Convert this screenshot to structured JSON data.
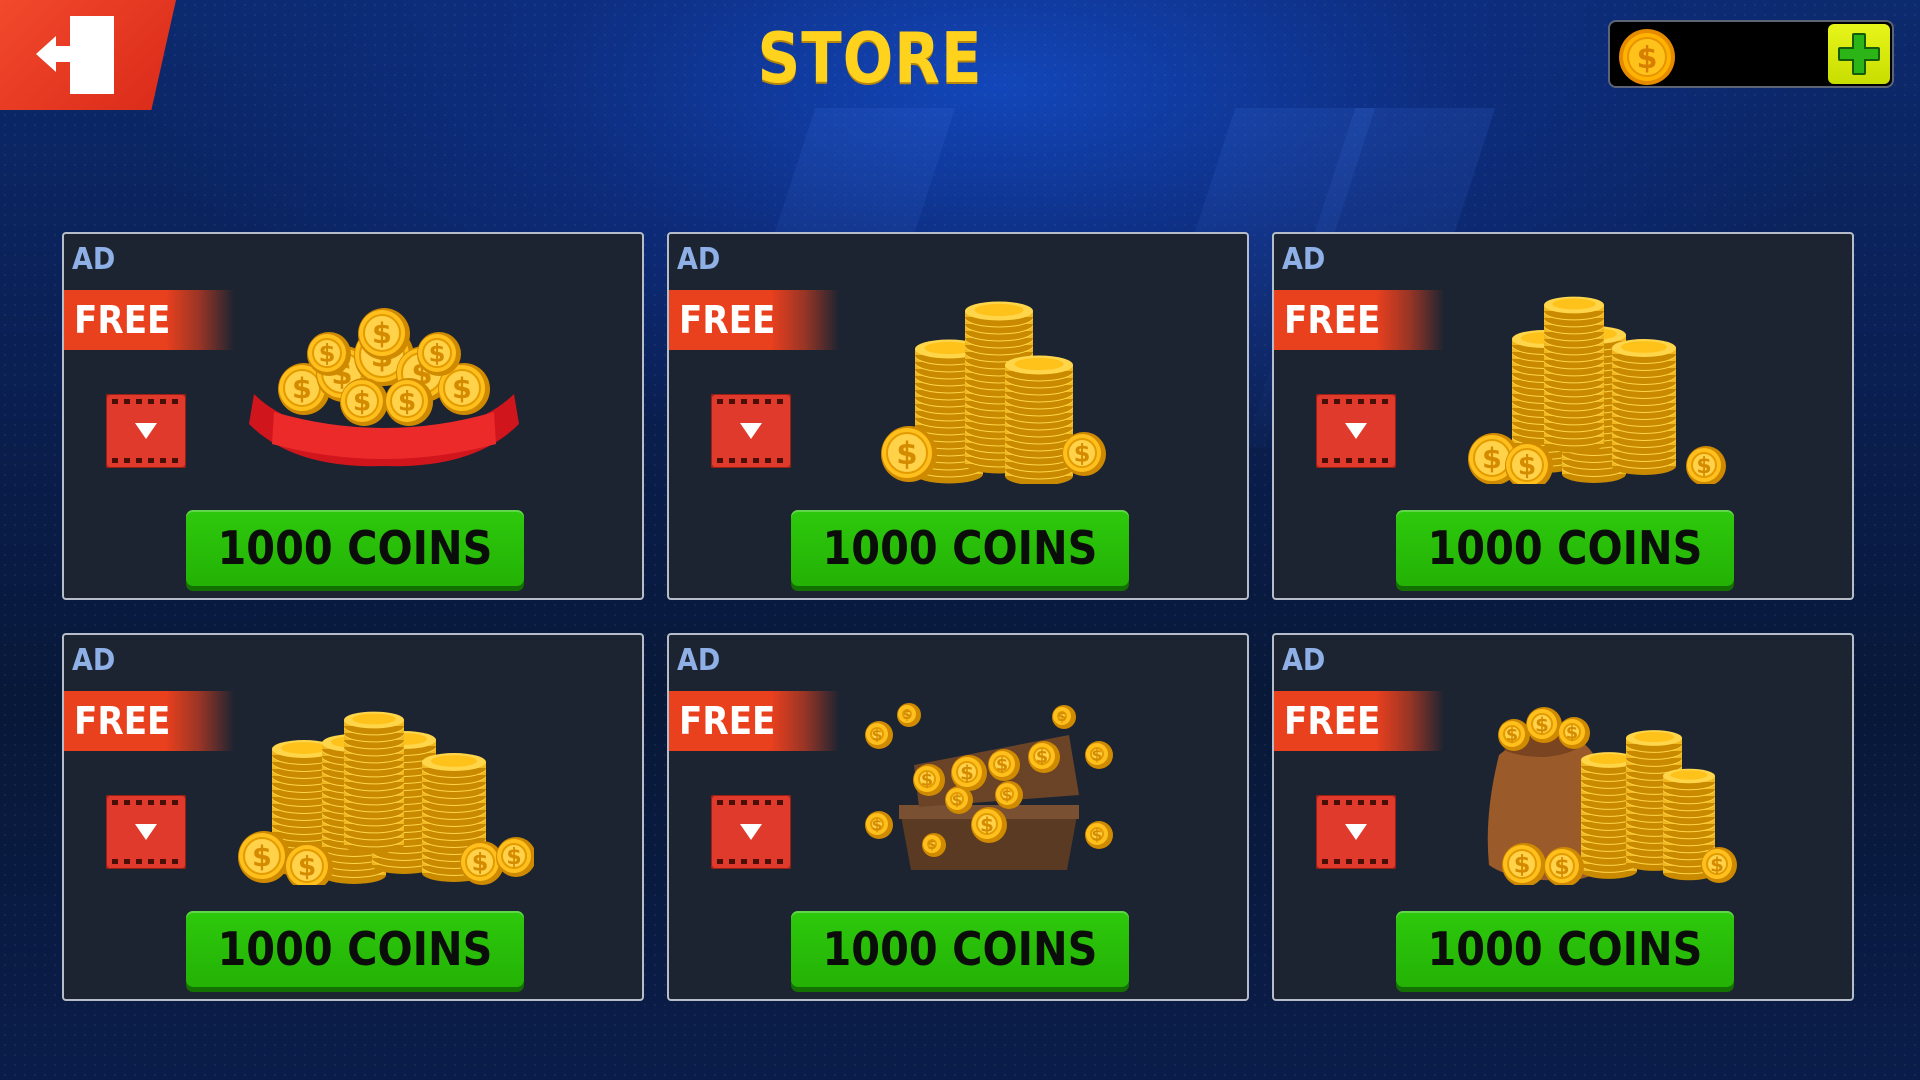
{
  "header": {
    "title": "STORE",
    "exit_icon": "exit-door-icon",
    "balance": {
      "coin_icon": "coin-icon",
      "amount": "",
      "add_icon": "plus-icon"
    }
  },
  "colors": {
    "title": "#ffd21e",
    "exit": "#e63a22",
    "free_ribbon": "#e9401e",
    "claim_button": "#24b205",
    "plus_button": "#d8e80a",
    "card_bg": "#1d2431",
    "ad_label": "#8fb0e6"
  },
  "cards": [
    {
      "ad_label": "AD",
      "badge": "FREE",
      "video_icon": "video-play-icon",
      "art": "coins-with-red-ribbon",
      "button": "1000 COINS"
    },
    {
      "ad_label": "AD",
      "badge": "FREE",
      "video_icon": "video-play-icon",
      "art": "coin-stacks",
      "button": "1000 COINS"
    },
    {
      "ad_label": "AD",
      "badge": "FREE",
      "video_icon": "video-play-icon",
      "art": "coin-stacks-large",
      "button": "1000 COINS"
    },
    {
      "ad_label": "AD",
      "badge": "FREE",
      "video_icon": "video-play-icon",
      "art": "coin-stacks-huge",
      "button": "1000 COINS"
    },
    {
      "ad_label": "AD",
      "badge": "FREE",
      "video_icon": "video-play-icon",
      "art": "treasure-chest",
      "button": "1000 COINS"
    },
    {
      "ad_label": "AD",
      "badge": "FREE",
      "video_icon": "video-play-icon",
      "art": "coin-sack",
      "button": "1000 COINS"
    }
  ]
}
